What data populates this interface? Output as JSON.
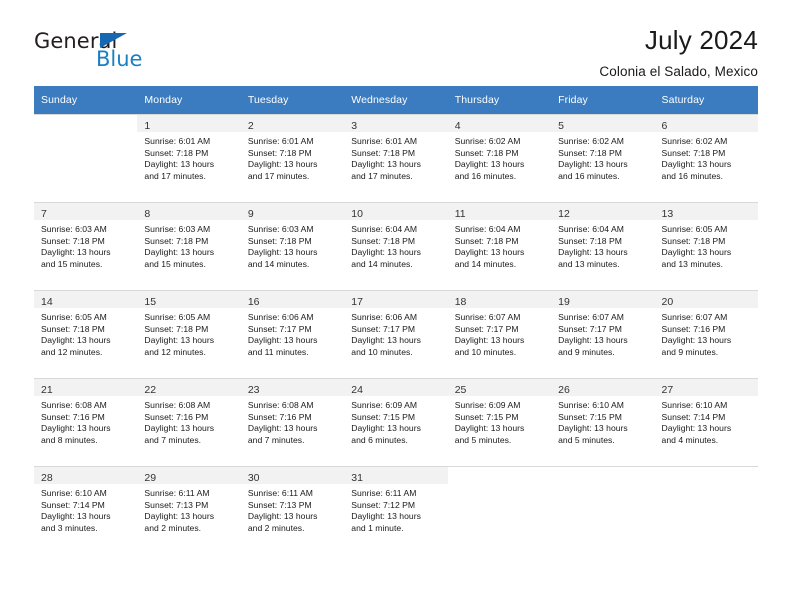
{
  "brand": {
    "name_part1": "General",
    "name_part2": "Blue",
    "triangle_color": "#1668b3",
    "blue_color": "#1b7fc4"
  },
  "header": {
    "title": "July 2024",
    "subtitle": "Colonia el Salado, Mexico"
  },
  "theme": {
    "header_row_bg": "#3b7cc0",
    "header_row_text": "#ffffff",
    "daynum_bar_bg": "#f2f2f2",
    "grid_line": "#d9d9d9"
  },
  "weekday_headers": [
    "Sunday",
    "Monday",
    "Tuesday",
    "Wednesday",
    "Thursday",
    "Friday",
    "Saturday"
  ],
  "weeks": [
    [
      {
        "day": "",
        "lines": []
      },
      {
        "day": "1",
        "lines": [
          "Sunrise: 6:01 AM",
          "Sunset: 7:18 PM",
          "Daylight: 13 hours",
          "and 17 minutes."
        ]
      },
      {
        "day": "2",
        "lines": [
          "Sunrise: 6:01 AM",
          "Sunset: 7:18 PM",
          "Daylight: 13 hours",
          "and 17 minutes."
        ]
      },
      {
        "day": "3",
        "lines": [
          "Sunrise: 6:01 AM",
          "Sunset: 7:18 PM",
          "Daylight: 13 hours",
          "and 17 minutes."
        ]
      },
      {
        "day": "4",
        "lines": [
          "Sunrise: 6:02 AM",
          "Sunset: 7:18 PM",
          "Daylight: 13 hours",
          "and 16 minutes."
        ]
      },
      {
        "day": "5",
        "lines": [
          "Sunrise: 6:02 AM",
          "Sunset: 7:18 PM",
          "Daylight: 13 hours",
          "and 16 minutes."
        ]
      },
      {
        "day": "6",
        "lines": [
          "Sunrise: 6:02 AM",
          "Sunset: 7:18 PM",
          "Daylight: 13 hours",
          "and 16 minutes."
        ]
      }
    ],
    [
      {
        "day": "7",
        "lines": [
          "Sunrise: 6:03 AM",
          "Sunset: 7:18 PM",
          "Daylight: 13 hours",
          "and 15 minutes."
        ]
      },
      {
        "day": "8",
        "lines": [
          "Sunrise: 6:03 AM",
          "Sunset: 7:18 PM",
          "Daylight: 13 hours",
          "and 15 minutes."
        ]
      },
      {
        "day": "9",
        "lines": [
          "Sunrise: 6:03 AM",
          "Sunset: 7:18 PM",
          "Daylight: 13 hours",
          "and 14 minutes."
        ]
      },
      {
        "day": "10",
        "lines": [
          "Sunrise: 6:04 AM",
          "Sunset: 7:18 PM",
          "Daylight: 13 hours",
          "and 14 minutes."
        ]
      },
      {
        "day": "11",
        "lines": [
          "Sunrise: 6:04 AM",
          "Sunset: 7:18 PM",
          "Daylight: 13 hours",
          "and 14 minutes."
        ]
      },
      {
        "day": "12",
        "lines": [
          "Sunrise: 6:04 AM",
          "Sunset: 7:18 PM",
          "Daylight: 13 hours",
          "and 13 minutes."
        ]
      },
      {
        "day": "13",
        "lines": [
          "Sunrise: 6:05 AM",
          "Sunset: 7:18 PM",
          "Daylight: 13 hours",
          "and 13 minutes."
        ]
      }
    ],
    [
      {
        "day": "14",
        "lines": [
          "Sunrise: 6:05 AM",
          "Sunset: 7:18 PM",
          "Daylight: 13 hours",
          "and 12 minutes."
        ]
      },
      {
        "day": "15",
        "lines": [
          "Sunrise: 6:05 AM",
          "Sunset: 7:18 PM",
          "Daylight: 13 hours",
          "and 12 minutes."
        ]
      },
      {
        "day": "16",
        "lines": [
          "Sunrise: 6:06 AM",
          "Sunset: 7:17 PM",
          "Daylight: 13 hours",
          "and 11 minutes."
        ]
      },
      {
        "day": "17",
        "lines": [
          "Sunrise: 6:06 AM",
          "Sunset: 7:17 PM",
          "Daylight: 13 hours",
          "and 10 minutes."
        ]
      },
      {
        "day": "18",
        "lines": [
          "Sunrise: 6:07 AM",
          "Sunset: 7:17 PM",
          "Daylight: 13 hours",
          "and 10 minutes."
        ]
      },
      {
        "day": "19",
        "lines": [
          "Sunrise: 6:07 AM",
          "Sunset: 7:17 PM",
          "Daylight: 13 hours",
          "and 9 minutes."
        ]
      },
      {
        "day": "20",
        "lines": [
          "Sunrise: 6:07 AM",
          "Sunset: 7:16 PM",
          "Daylight: 13 hours",
          "and 9 minutes."
        ]
      }
    ],
    [
      {
        "day": "21",
        "lines": [
          "Sunrise: 6:08 AM",
          "Sunset: 7:16 PM",
          "Daylight: 13 hours",
          "and 8 minutes."
        ]
      },
      {
        "day": "22",
        "lines": [
          "Sunrise: 6:08 AM",
          "Sunset: 7:16 PM",
          "Daylight: 13 hours",
          "and 7 minutes."
        ]
      },
      {
        "day": "23",
        "lines": [
          "Sunrise: 6:08 AM",
          "Sunset: 7:16 PM",
          "Daylight: 13 hours",
          "and 7 minutes."
        ]
      },
      {
        "day": "24",
        "lines": [
          "Sunrise: 6:09 AM",
          "Sunset: 7:15 PM",
          "Daylight: 13 hours",
          "and 6 minutes."
        ]
      },
      {
        "day": "25",
        "lines": [
          "Sunrise: 6:09 AM",
          "Sunset: 7:15 PM",
          "Daylight: 13 hours",
          "and 5 minutes."
        ]
      },
      {
        "day": "26",
        "lines": [
          "Sunrise: 6:10 AM",
          "Sunset: 7:15 PM",
          "Daylight: 13 hours",
          "and 5 minutes."
        ]
      },
      {
        "day": "27",
        "lines": [
          "Sunrise: 6:10 AM",
          "Sunset: 7:14 PM",
          "Daylight: 13 hours",
          "and 4 minutes."
        ]
      }
    ],
    [
      {
        "day": "28",
        "lines": [
          "Sunrise: 6:10 AM",
          "Sunset: 7:14 PM",
          "Daylight: 13 hours",
          "and 3 minutes."
        ]
      },
      {
        "day": "29",
        "lines": [
          "Sunrise: 6:11 AM",
          "Sunset: 7:13 PM",
          "Daylight: 13 hours",
          "and 2 minutes."
        ]
      },
      {
        "day": "30",
        "lines": [
          "Sunrise: 6:11 AM",
          "Sunset: 7:13 PM",
          "Daylight: 13 hours",
          "and 2 minutes."
        ]
      },
      {
        "day": "31",
        "lines": [
          "Sunrise: 6:11 AM",
          "Sunset: 7:12 PM",
          "Daylight: 13 hours",
          "and 1 minute."
        ]
      },
      {
        "day": "",
        "lines": []
      },
      {
        "day": "",
        "lines": []
      },
      {
        "day": "",
        "lines": []
      }
    ]
  ]
}
